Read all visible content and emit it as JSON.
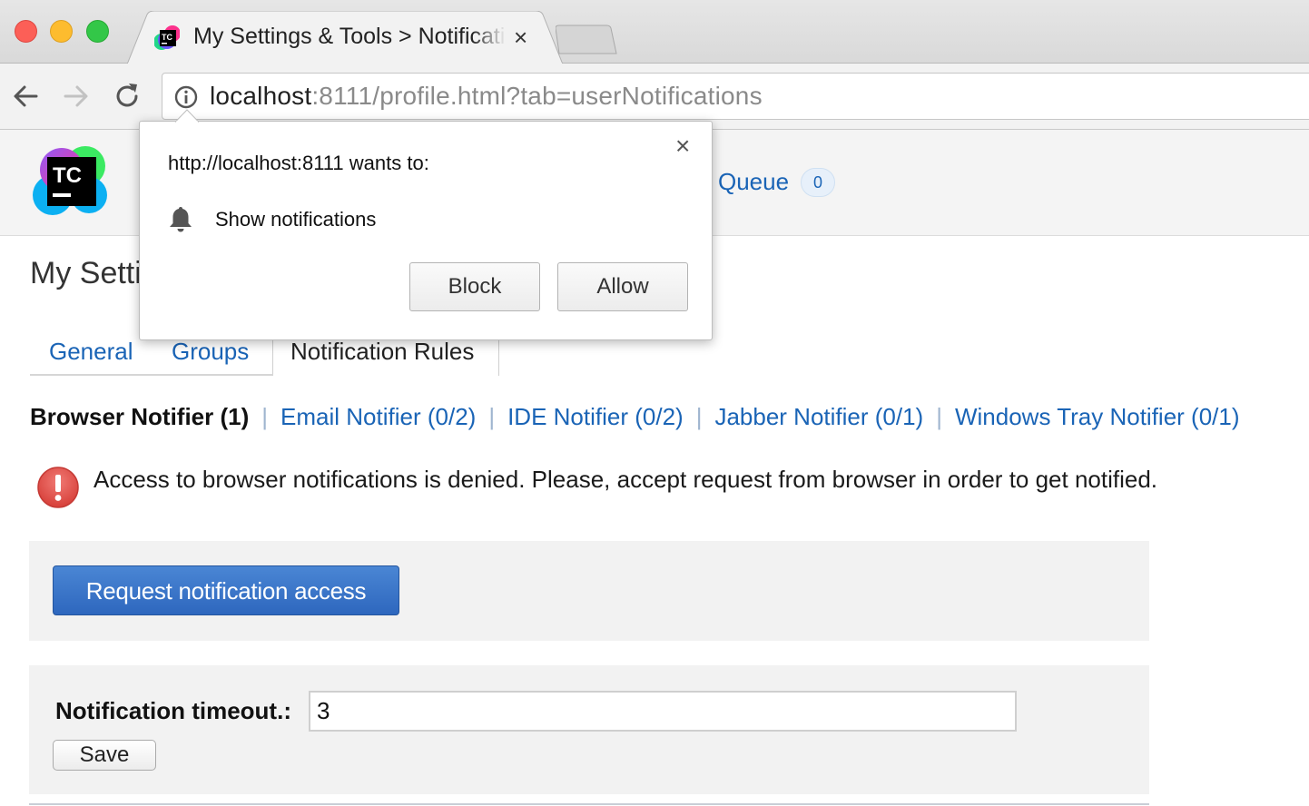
{
  "browser": {
    "tab_title": "My Settings & Tools > Notifications",
    "tab_close": "×",
    "url_host": "localhost",
    "url_rest": ":8111/profile.html?tab=userNotifications"
  },
  "header": {
    "queue_label": "l Queue",
    "queue_count": "0"
  },
  "page": {
    "title": "My Setti",
    "tabs": [
      {
        "label": "General"
      },
      {
        "label": "Groups"
      },
      {
        "label": "Notification Rules"
      }
    ],
    "notifiers": {
      "current": "Browser Notifier (1)",
      "separator": "|",
      "links": [
        "Email Notifier (0/2)",
        "IDE Notifier (0/2)",
        "Jabber Notifier (0/1)",
        "Windows Tray Notifier (0/1)"
      ]
    },
    "warning": "Access to browser notifications is denied. Please, accept request from browser in order to get notified.",
    "request_button": "Request notification access",
    "timeout_label": "Notification timeout.:",
    "timeout_value": "3",
    "save_button": "Save"
  },
  "popup": {
    "origin": "http://localhost:8111 wants to:",
    "permission": "Show notifications",
    "close": "×",
    "block_button": "Block",
    "allow_button": "Allow"
  },
  "colors": {
    "link": "#1a64b6",
    "primary_button": "#2e67be",
    "warning_icon": "#e0504a"
  }
}
